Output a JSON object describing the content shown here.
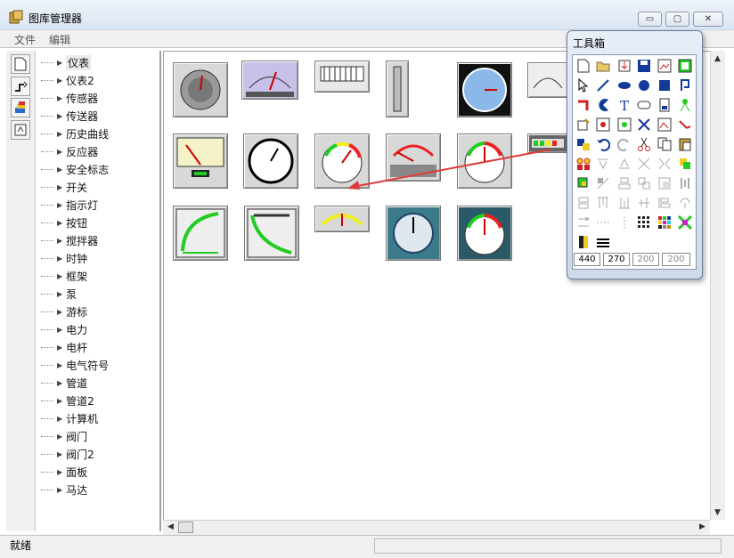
{
  "window": {
    "title": "图库管理器"
  },
  "caption_buttons": {
    "minimize": "▭",
    "maximize": "▢",
    "close": "✕"
  },
  "menu": {
    "items": [
      {
        "label": "文件"
      },
      {
        "label": "编辑"
      }
    ]
  },
  "left_toolbar": {
    "buttons": [
      "new-page-icon",
      "connect-icon",
      "layers-icon",
      "sync-icon"
    ]
  },
  "tree": {
    "items": [
      {
        "label": "仪表"
      },
      {
        "label": "仪表2"
      },
      {
        "label": "传感器"
      },
      {
        "label": "传送器"
      },
      {
        "label": "历史曲线"
      },
      {
        "label": "反应器"
      },
      {
        "label": "安全标志"
      },
      {
        "label": "开关"
      },
      {
        "label": "指示灯"
      },
      {
        "label": "按钮"
      },
      {
        "label": "搅拌器"
      },
      {
        "label": "时钟"
      },
      {
        "label": "框架"
      },
      {
        "label": "泵"
      },
      {
        "label": "游标"
      },
      {
        "label": "电力"
      },
      {
        "label": "电杆"
      },
      {
        "label": "电气符号"
      },
      {
        "label": "管道"
      },
      {
        "label": "管道2"
      },
      {
        "label": "计算机"
      },
      {
        "label": "阀门"
      },
      {
        "label": "阀门2"
      },
      {
        "label": "面板"
      },
      {
        "label": "马达"
      }
    ]
  },
  "gallery": {
    "thumb_names": [
      "round-dial-gauge",
      "vertical-scale-gauge",
      "bar-segment-indicator",
      "vertical-bar-gauge",
      "blue-clock-gauge",
      "semicircle-meter",
      "voltmeter-panel",
      "black-dial-gauge",
      "color-arc-gauge",
      "analog-panel-meter",
      "tricolor-dial-gauge",
      "led-bar-indicator",
      "quarter-arc-meter",
      "curved-scale-meter",
      "flat-arc-meter",
      "teal-round-gauge",
      "red-needle-gauge"
    ]
  },
  "status": {
    "text": "就绪"
  },
  "toolbox": {
    "title": "工具箱",
    "coords": [
      "440",
      "270",
      "200",
      "200"
    ]
  },
  "colors": {
    "titlebar": "#dbe6f3",
    "accent_arrow": "#e03a3a",
    "toolbox_border": "#6d7f99"
  }
}
